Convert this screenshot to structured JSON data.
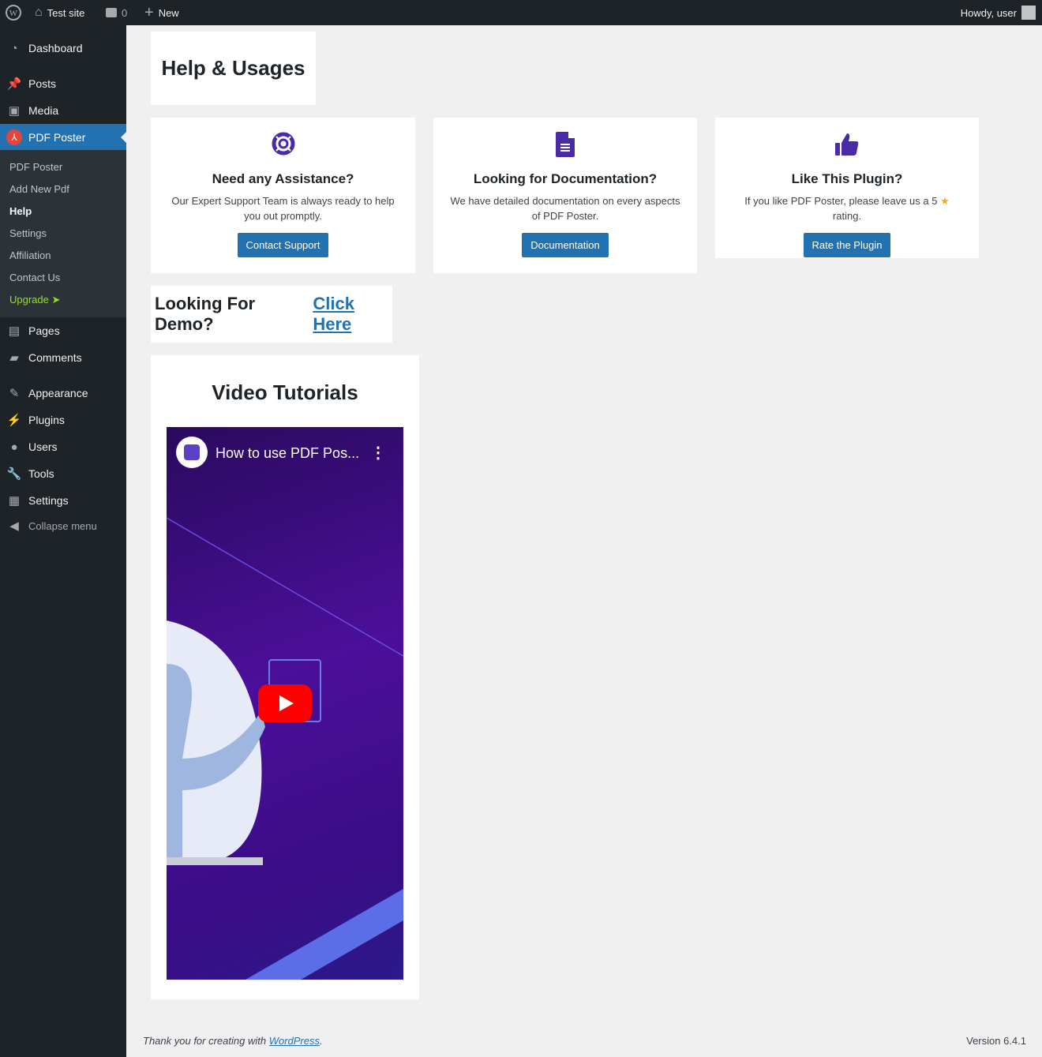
{
  "adminbar": {
    "site": "Test site",
    "comments": "0",
    "new": "New",
    "howdy": "Howdy, user"
  },
  "menu": {
    "dashboard": "Dashboard",
    "posts": "Posts",
    "media": "Media",
    "pdf_poster": "PDF Poster",
    "pages": "Pages",
    "comments": "Comments",
    "appearance": "Appearance",
    "plugins": "Plugins",
    "users": "Users",
    "tools": "Tools",
    "settings": "Settings",
    "collapse": "Collapse menu"
  },
  "submenu": [
    "PDF Poster",
    "Add New Pdf",
    "Help",
    "Settings",
    "Affiliation",
    "Contact Us",
    "Upgrade"
  ],
  "page_title": "Help & Usages",
  "cards": [
    {
      "title": "Need any Assistance?",
      "text": "Our Expert Support Team is always ready to help you out promptly.",
      "button": "Contact Support"
    },
    {
      "title": "Looking for Documentation?",
      "text": "We have detailed documentation on every aspects of PDF Poster.",
      "button": "Documentation"
    },
    {
      "title": "Like This Plugin?",
      "text_before": "If you like PDF Poster, please leave us a 5",
      "text_after": "rating.",
      "button": "Rate the Plugin"
    }
  ],
  "demo": {
    "text": "Looking For Demo?",
    "link": "Click Here"
  },
  "video": {
    "heading": "Video Tutorials",
    "title": "How to use PDF Pos..."
  },
  "footer": {
    "thanks": "Thank you for creating with",
    "link": "WordPress",
    "version": "Version 6.4.1"
  },
  "colors": {
    "accent": "#2271b1",
    "icon": "#4b2aa6"
  }
}
